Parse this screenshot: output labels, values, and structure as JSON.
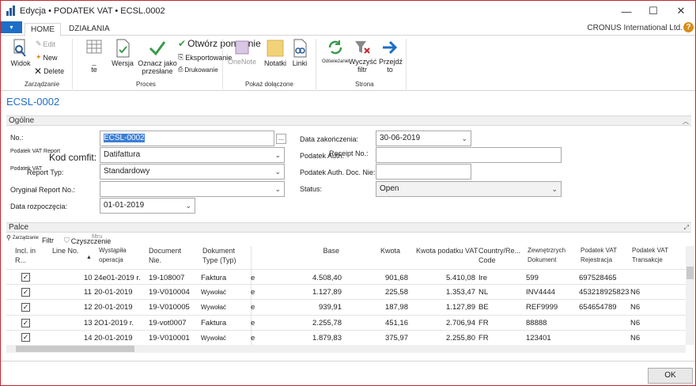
{
  "window": {
    "title": "Edycja • PODATEK VAT • ECSL.0002",
    "minimize": "—",
    "maximize": "☐",
    "close": "✕"
  },
  "ribbon_tabs": {
    "file_glyph": "▾",
    "home": "HOME",
    "actions": "DZIAŁANIA",
    "company": "CRONUS International Ltd.",
    "help": "?"
  },
  "ribbon": {
    "manage": {
      "label": "Zarządzanie",
      "view": "Widok",
      "edit": "Edit",
      "new": "New",
      "delete": "Delete"
    },
    "process": {
      "label": "Proces",
      "btn_unknown": "_",
      "btn_unknown_sub": "te",
      "version": "Wersja",
      "mark_sent": "Oznacz jako przesłane",
      "reopen": "Otwórz ponownie",
      "export": "Eksportowanie",
      "print": "Drukowanie"
    },
    "show_attached": {
      "label": "Pokaż dołączone",
      "onenote": "OneNote",
      "notes": "Notatki",
      "links": "Linki"
    },
    "page": {
      "label": "Strona",
      "refresh": "Odświeżanie",
      "clear_filter": "Wyczyść filtr",
      "goto": "Przejdź to"
    }
  },
  "page_title": "ECSL-0002",
  "general": {
    "tab_label": "Ogólne",
    "collapse": "︿",
    "no_label": "No.:",
    "no_value": "ECSL-0002",
    "report_config_code_label_small": "Podatek VAT Report",
    "report_config_code_label_big": "Kod comfit:",
    "report_config_code_value": "Datifattura",
    "report_type_label_small": "Podatek VAT",
    "report_type_label_big": "Report Typ:",
    "report_type_value": "Standardowy",
    "original_report_label": "Oryginał Report No.:",
    "original_report_value": "",
    "start_date_label": "Data rozpoczęcia:",
    "start_date_value": "01-01-2019",
    "end_date_label": "Data zakończenia:",
    "end_date_value": "30-06-2019",
    "auth_receipt_label": "Podatek Auth.",
    "auth_receipt_label_overlay": "Receipt No.:",
    "auth_receipt_value": "",
    "auth_doc_label": "Podatek Auth. Doc. Nie:",
    "auth_doc_value": "",
    "status_label": "Status:",
    "status_value": "Open",
    "lookup": "..."
  },
  "lines": {
    "tab_label": "Palce",
    "expand": "⤢",
    "toolbar": {
      "manage_small": "Zarządzanie",
      "filter": "Filtr",
      "clear_filter": "Czyszczenie",
      "clear_filter_overlay": "filtru"
    },
    "columns": {
      "incl": "Incl. in R...",
      "line_no": "Line No.",
      "sort_glyph": "▲",
      "posting_date": "Wystąpiła operacja",
      "document_no": "Document Nie.",
      "document_type": "Dokument Type (Typ)",
      "base": "Base",
      "amount": "Kwota",
      "vat_amount": "Kwota podatku VAT",
      "country": "Country/Re... Code",
      "external_doc": "Zewnętrzrych Dokument",
      "vat_reg": "Podatek VAT Rejestracja",
      "vat_trans": "Podatek VAT Transakcje"
    },
    "rows": [
      {
        "incl": "✓",
        "line_no": "10",
        "posting_date": "24e01-2019 r.",
        "document_no": "19-108007",
        "document_type": "Faktura",
        "base": "4.508,40",
        "amount": "901,68",
        "vat_amount": "5.410,08",
        "country": "Ire",
        "external_doc": "599",
        "vat_reg": "697528465",
        "vat_trans": "",
        "stub": "e"
      },
      {
        "incl": "✓",
        "line_no": "11",
        "posting_date": "20-01-2019",
        "document_no": "19-V010004",
        "document_type": "Wywołać",
        "base": "1.127,89",
        "amount": "225,58",
        "vat_amount": "1.353,47",
        "country": "NL",
        "external_doc": "INV4444",
        "vat_reg": "453218925823",
        "vat_trans": "N6",
        "stub": "e"
      },
      {
        "incl": "✓",
        "line_no": "12",
        "posting_date": "20-01-2019",
        "document_no": "19-V010005",
        "document_type": "Wywołać",
        "base": "939,91",
        "amount": "187,98",
        "vat_amount": "1.127,89",
        "country": "BE",
        "external_doc": "REF9999",
        "vat_reg": "654654789",
        "vat_trans": "N6",
        "stub": "e"
      },
      {
        "incl": "✓",
        "line_no": "13",
        "posting_date": "2O1-2019 r.",
        "document_no": "19-vot0007",
        "document_type": "Faktura",
        "base": "2.255,78",
        "amount": "451,16",
        "vat_amount": "2.706,94",
        "country": "FR",
        "external_doc": "88888",
        "vat_reg": "",
        "vat_trans": "N6",
        "stub": "e"
      },
      {
        "incl": "✓",
        "line_no": "14",
        "posting_date": "20-01-2019",
        "document_no": "19-V010001",
        "document_type": "Wywołać",
        "base": "1.879,83",
        "amount": "375,97",
        "vat_amount": "2.255,80",
        "country": "FR",
        "external_doc": "123401",
        "vat_reg": "",
        "vat_trans": "N6",
        "stub": "e"
      }
    ]
  },
  "footer": {
    "ok": "OK"
  },
  "colors": {
    "accent": "#1d6ec6",
    "border": "#c2272d",
    "selection": "#3b7fd6",
    "help": "#d98c1a"
  }
}
